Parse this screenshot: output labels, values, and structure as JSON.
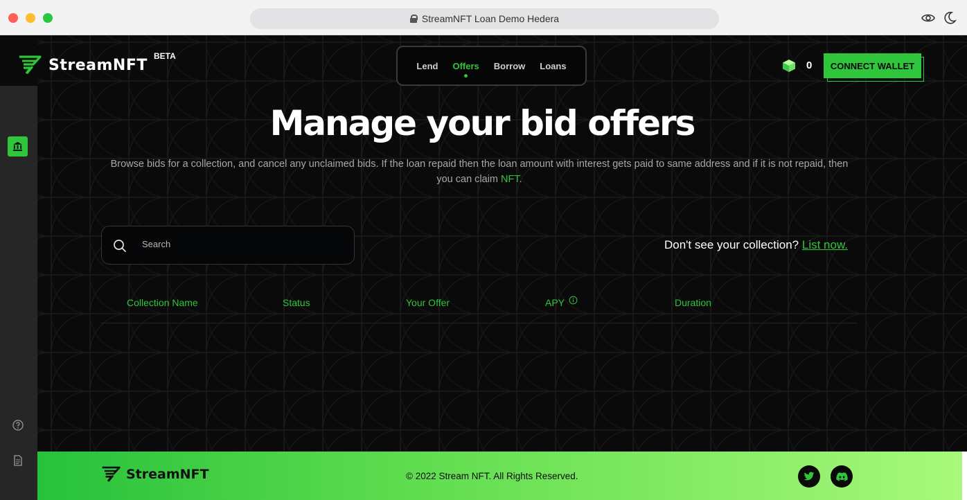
{
  "browser": {
    "url_title": "StreamNFT Loan Demo Hedera"
  },
  "header": {
    "logo_text": "StreamNFT",
    "beta": "BETA",
    "nav": [
      {
        "label": "Lend"
      },
      {
        "label": "Offers"
      },
      {
        "label": "Borrow"
      },
      {
        "label": "Loans"
      }
    ],
    "balance": "0",
    "connect_label": "CONNECT WALLET"
  },
  "hero": {
    "title": "Manage your bid offers",
    "subtitle_before": "Browse bids for a collection, and cancel any unclaimed bids. If the loan repaid then the loan amount with interest gets paid to same address and if it is not repaid, then you can claim ",
    "subtitle_highlight": "NFT",
    "subtitle_after": "."
  },
  "search": {
    "placeholder": "Search"
  },
  "cta": {
    "text": "Don't see your collection? ",
    "link": "List now."
  },
  "table": {
    "columns": [
      "Collection Name",
      "Status",
      "Your Offer",
      "APY",
      "Duration"
    ]
  },
  "footer": {
    "logo_text": "StreamNFT",
    "copyright": "© 2022 Stream NFT. All Rights Reserved."
  },
  "colors": {
    "accent": "#2fc63c",
    "background": "#0a0a0a"
  }
}
